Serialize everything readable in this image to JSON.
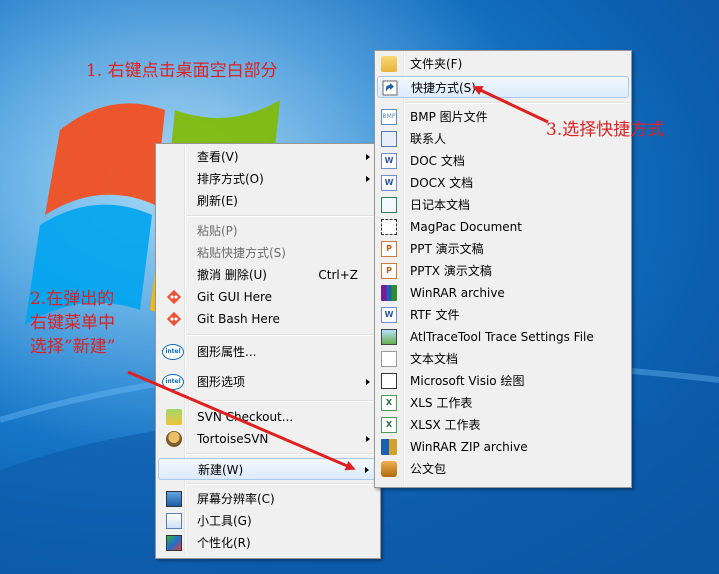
{
  "annotations": {
    "step1": "1. 右键点击桌面空白部分",
    "step2_line1": "2.在弹出的",
    "step2_line2": "右键菜单中",
    "step2_line3": "选择”新建”",
    "step3": "3.选择快捷方式"
  },
  "context_menu": {
    "items": [
      {
        "label": "查看(V)",
        "has_submenu": true,
        "enabled": true
      },
      {
        "label": "排序方式(O)",
        "has_submenu": true,
        "enabled": true
      },
      {
        "label": "刷新(E)",
        "enabled": true
      },
      {
        "label": "粘贴(P)",
        "enabled": false
      },
      {
        "label": "粘贴快捷方式(S)",
        "enabled": false
      },
      {
        "label": "撤消 删除(U)",
        "shortcut": "Ctrl+Z",
        "enabled": true
      },
      {
        "label": "Git GUI Here",
        "icon": "git-icon",
        "enabled": true
      },
      {
        "label": "Git Bash Here",
        "icon": "git-icon",
        "enabled": true
      },
      {
        "label": "图形属性...",
        "icon": "intel-icon",
        "enabled": true
      },
      {
        "label": "图形选项",
        "icon": "intel-icon",
        "has_submenu": true,
        "enabled": true
      },
      {
        "label": "SVN Checkout...",
        "icon": "svn-checkout-icon",
        "enabled": true
      },
      {
        "label": "TortoiseSVN",
        "icon": "tortoise-icon",
        "has_submenu": true,
        "enabled": true
      },
      {
        "label": "新建(W)",
        "has_submenu": true,
        "enabled": true,
        "highlighted": true
      },
      {
        "label": "屏幕分辨率(C)",
        "icon": "monitor-icon",
        "enabled": true
      },
      {
        "label": "小工具(G)",
        "icon": "gadget-icon",
        "enabled": true
      },
      {
        "label": "个性化(R)",
        "icon": "personalize-icon",
        "enabled": true
      }
    ]
  },
  "new_submenu": {
    "items": [
      {
        "label": "文件夹(F)",
        "icon": "folder-icon"
      },
      {
        "label": "快捷方式(S)",
        "icon": "shortcut-icon",
        "highlighted": true
      },
      {
        "label": "BMP 图片文件",
        "icon": "bmp-icon"
      },
      {
        "label": "联系人",
        "icon": "contact-icon"
      },
      {
        "label": "DOC 文档",
        "icon": "doc-icon"
      },
      {
        "label": "DOCX 文档",
        "icon": "docx-icon"
      },
      {
        "label": "日记本文档",
        "icon": "journal-icon"
      },
      {
        "label": "MagPac Document",
        "icon": "magpac-icon"
      },
      {
        "label": "PPT 演示文稿",
        "icon": "ppt-icon"
      },
      {
        "label": "PPTX 演示文稿",
        "icon": "pptx-icon"
      },
      {
        "label": "WinRAR archive",
        "icon": "winrar-icon"
      },
      {
        "label": "RTF 文件",
        "icon": "rtf-icon"
      },
      {
        "label": "AtlTraceTool Trace Settings File",
        "icon": "atltrace-icon"
      },
      {
        "label": "文本文档",
        "icon": "text-icon"
      },
      {
        "label": "Microsoft Visio 绘图",
        "icon": "visio-icon"
      },
      {
        "label": "XLS 工作表",
        "icon": "xls-icon"
      },
      {
        "label": "XLSX 工作表",
        "icon": "xlsx-icon"
      },
      {
        "label": "WinRAR ZIP archive",
        "icon": "winrar-zip-icon"
      },
      {
        "label": "公文包",
        "icon": "briefcase-icon"
      }
    ]
  },
  "icon_text": {
    "intel": "intel",
    "bmp": "BMP",
    "w": "W",
    "x": "X",
    "p": "P"
  },
  "colors": {
    "annotation": "#e02020",
    "highlight_border": "#a9c9ee"
  }
}
